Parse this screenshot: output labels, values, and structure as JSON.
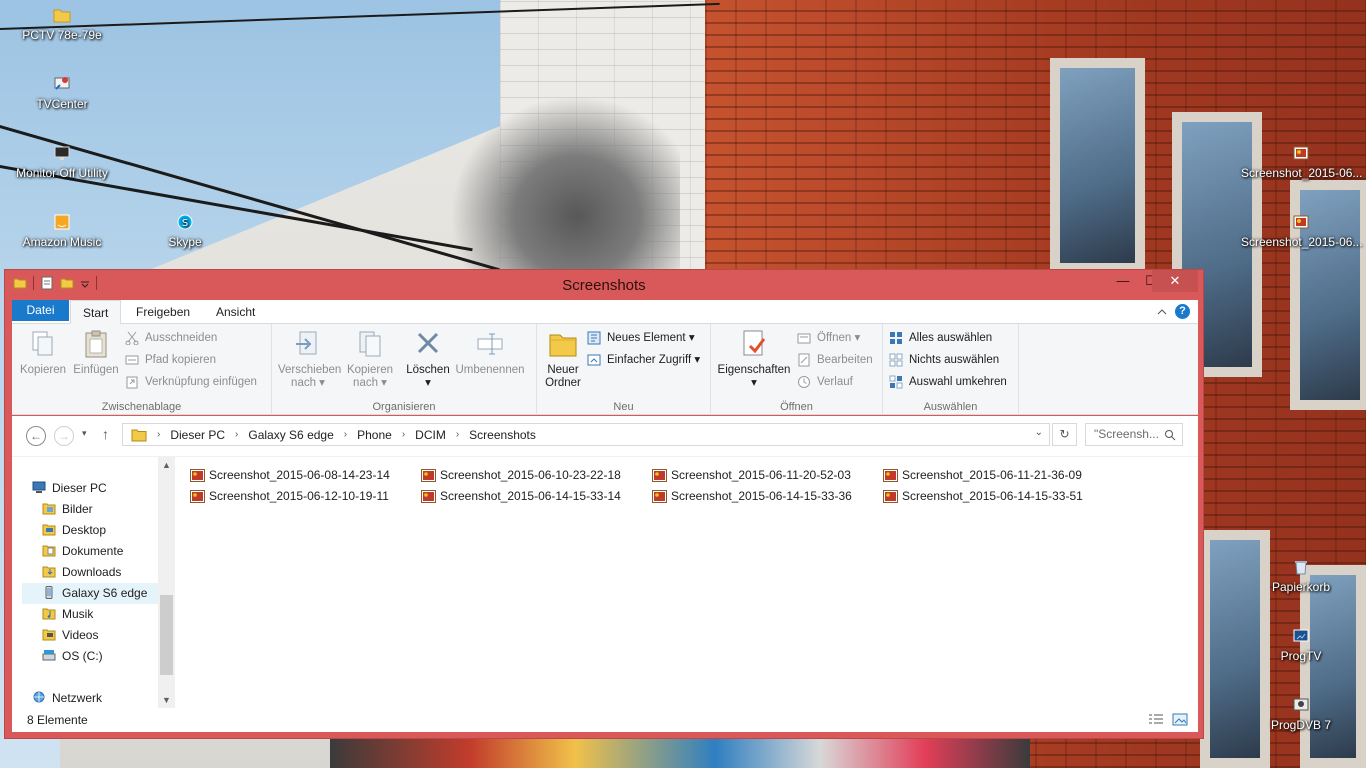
{
  "desktop": {
    "left_icons": [
      {
        "label": "PCTV 78e-79e",
        "icon": "folder-icon"
      },
      {
        "label": "TVCenter",
        "icon": "tvcenter-icon"
      },
      {
        "label": "Monitor Off Utility",
        "icon": "monitor-icon"
      },
      {
        "label": "Amazon Music",
        "icon": "amazon-music-icon"
      },
      {
        "label": "Skype",
        "icon": "skype-icon"
      }
    ],
    "right_icons": [
      {
        "label": "Screenshot_2015-06...",
        "icon": "image-file-icon"
      },
      {
        "label": "Screenshot_2015-06...",
        "icon": "image-file-icon"
      },
      {
        "label": "Papierkorb",
        "icon": "recycle-bin-icon"
      },
      {
        "label": "ProgTV",
        "icon": "progtv-icon"
      },
      {
        "label": "ProgDVB 7",
        "icon": "progdvb-icon"
      }
    ]
  },
  "window": {
    "title": "Screenshots",
    "accent": "#d9595a",
    "controls": {
      "minimize": "—",
      "maximize": "☐",
      "close": "✕"
    }
  },
  "ribbon": {
    "tabs": {
      "file": "Datei",
      "start": "Start",
      "share": "Freigeben",
      "view": "Ansicht"
    },
    "clipboard": {
      "label": "Zwischenablage",
      "copy": "Kopieren",
      "paste": "Einfügen",
      "cut": "Ausschneiden",
      "copy_path": "Pfad kopieren",
      "paste_shortcut": "Verknüpfung einfügen"
    },
    "organize": {
      "label": "Organisieren",
      "move_to_1": "Verschieben",
      "move_to_2": "nach",
      "copy_to_1": "Kopieren",
      "copy_to_2": "nach",
      "delete": "Löschen",
      "rename": "Umbenennen"
    },
    "new": {
      "label": "Neu",
      "new_folder_1": "Neuer",
      "new_folder_2": "Ordner",
      "new_item": "Neues Element",
      "easy_access": "Einfacher Zugriff"
    },
    "open": {
      "label": "Öffnen",
      "properties": "Eigenschaften",
      "open": "Öffnen",
      "edit": "Bearbeiten",
      "history": "Verlauf"
    },
    "select": {
      "label": "Auswählen",
      "select_all": "Alles auswählen",
      "select_none": "Nichts auswählen",
      "invert": "Auswahl umkehren"
    }
  },
  "address": {
    "breadcrumbs": [
      "Dieser PC",
      "Galaxy S6 edge",
      "Phone",
      "DCIM",
      "Screenshots"
    ],
    "search_placeholder": "\"Screensh..."
  },
  "nav": {
    "items": [
      {
        "label": "Dieser PC",
        "icon": "this-pc-icon"
      },
      {
        "label": "Bilder",
        "icon": "pictures-folder-icon"
      },
      {
        "label": "Desktop",
        "icon": "desktop-folder-icon"
      },
      {
        "label": "Dokumente",
        "icon": "documents-folder-icon"
      },
      {
        "label": "Downloads",
        "icon": "downloads-folder-icon"
      },
      {
        "label": "Galaxy S6 edge",
        "icon": "phone-device-icon"
      },
      {
        "label": "Musik",
        "icon": "music-folder-icon"
      },
      {
        "label": "Videos",
        "icon": "videos-folder-icon"
      },
      {
        "label": "OS (C:)",
        "icon": "drive-icon"
      },
      {
        "label": "Netzwerk",
        "icon": "network-icon"
      }
    ]
  },
  "files": [
    "Screenshot_2015-06-08-14-23-14",
    "Screenshot_2015-06-10-23-22-18",
    "Screenshot_2015-06-11-20-52-03",
    "Screenshot_2015-06-11-21-36-09",
    "Screenshot_2015-06-12-10-19-11",
    "Screenshot_2015-06-14-15-33-14",
    "Screenshot_2015-06-14-15-33-36",
    "Screenshot_2015-06-14-15-33-51"
  ],
  "status": {
    "count": "8 Elemente"
  }
}
